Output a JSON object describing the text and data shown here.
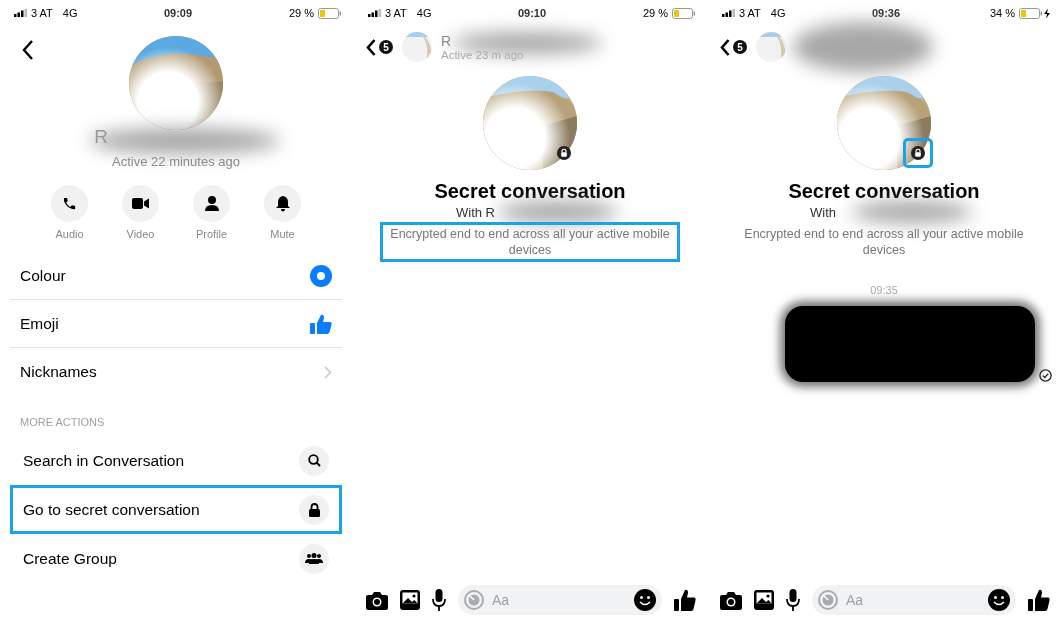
{
  "panels": [
    {
      "kind": "details",
      "status": {
        "carrier": "3 AT",
        "network": "4G",
        "time": "09:09",
        "battery": "29 %",
        "charging": false
      },
      "name": "R",
      "active": "Active 22 minutes ago",
      "quick_actions": [
        {
          "kind": "audio",
          "label": "Audio"
        },
        {
          "kind": "video",
          "label": "Video"
        },
        {
          "kind": "profile",
          "label": "Profile"
        },
        {
          "kind": "mute",
          "label": "Mute"
        }
      ],
      "settings": [
        {
          "kind": "colour",
          "label": "Colour"
        },
        {
          "kind": "emoji",
          "label": "Emoji"
        },
        {
          "kind": "chevron",
          "label": "Nicknames"
        }
      ],
      "section": "MORE ACTIONS",
      "actions": [
        {
          "kind": "search",
          "label": "Search in Conversation",
          "highlighted": false
        },
        {
          "kind": "lock",
          "label": "Go to secret conversation",
          "highlighted": true
        },
        {
          "kind": "group",
          "label": "Create Group",
          "highlighted": false
        }
      ]
    },
    {
      "kind": "secret",
      "status": {
        "carrier": "3 AT",
        "network": "4G",
        "time": "09:10",
        "battery": "29 %",
        "charging": false
      },
      "badge": "5",
      "name": "R",
      "active": "Active 23 m ago",
      "lock_highlighted": false,
      "title": "Secret conversation",
      "with": "With R",
      "description": "Encrypted end to end across all your active mobile devices",
      "description_highlighted": true,
      "composer": {
        "placeholder": "Aa"
      }
    },
    {
      "kind": "secret",
      "status": {
        "carrier": "3 AT",
        "network": "4G",
        "time": "09:36",
        "battery": "34 %",
        "charging": true
      },
      "badge": "5",
      "lock_highlighted": true,
      "title": "Secret conversation",
      "with": "With",
      "description": "Encrypted end to end across all your active mobile devices",
      "description_highlighted": false,
      "timestamp": "09:35",
      "message": {
        "redacted": true,
        "read": true
      },
      "composer": {
        "placeholder": "Aa"
      }
    }
  ]
}
